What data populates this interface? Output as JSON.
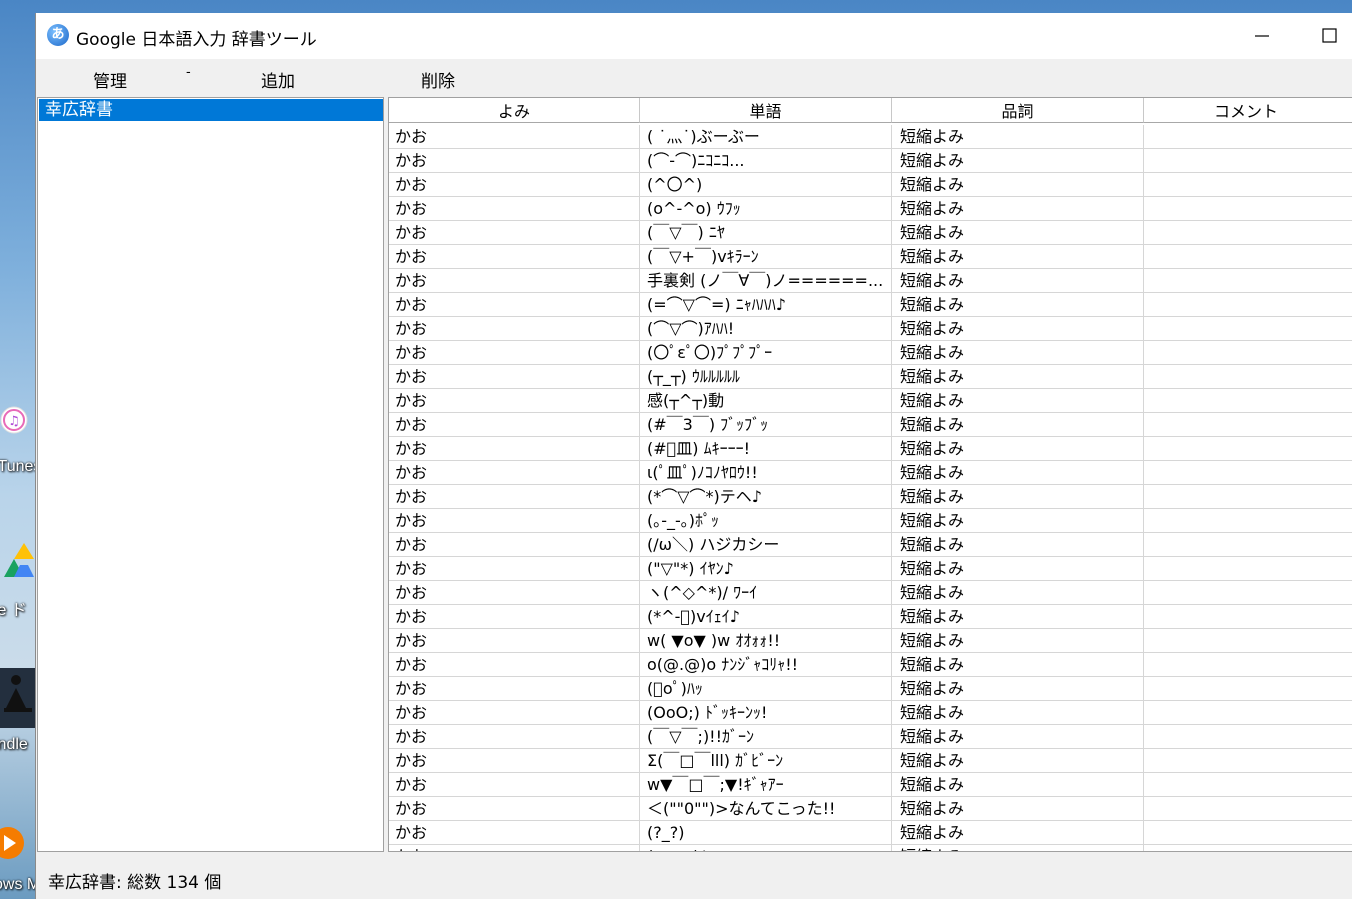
{
  "desktop": {
    "icons": [
      {
        "label": "iTunes",
        "name": "itunes-icon"
      },
      {
        "label": "le ド",
        "name": "google-drive-icon"
      },
      {
        "label": "indle",
        "name": "kindle-icon"
      },
      {
        "label": "ows M",
        "name": "windows-media-icon"
      }
    ]
  },
  "window": {
    "title": "Google 日本語入力 辞書ツール",
    "minimize_label": "—",
    "maximize_label": "☐"
  },
  "menu": {
    "manage": "管理",
    "separator": "-",
    "add": "追加",
    "delete": "削除"
  },
  "dictionaries": [
    "幸広辞書"
  ],
  "table": {
    "columns": [
      "よみ",
      "単語",
      "品詞",
      "コメント"
    ],
    "rows": [
      [
        "かお",
        "( ˙灬˙)ぶーぶー",
        "短縮よみ",
        ""
      ],
      [
        "かお",
        "(⌒-⌒)ﾆｺﾆｺ...",
        "短縮よみ",
        ""
      ],
      [
        "かお",
        "(^〇^)",
        "短縮よみ",
        ""
      ],
      [
        "かお",
        "(o^-^o) ｳﾌｯ",
        "短縮よみ",
        ""
      ],
      [
        "かお",
        "(￣▽￣) ﾆﾔ",
        "短縮よみ",
        ""
      ],
      [
        "かお",
        "(￣▽+￣)vｷﾗｰﾝ",
        "短縮よみ",
        ""
      ],
      [
        "かお",
        "手裏剣 (ノ￣∀￣)ノ======...",
        "短縮よみ",
        ""
      ],
      [
        "かお",
        "(=⌒▽⌒=) ﾆｬﾊﾊﾊ♪",
        "短縮よみ",
        ""
      ],
      [
        "かお",
        "(⌒▽⌒)ｱﾊﾊ!",
        "短縮よみ",
        ""
      ],
      [
        "かお",
        "(〇ﾟεﾟ〇)ﾌﾟﾌﾟﾌﾟｰ",
        "短縮よみ",
        ""
      ],
      [
        "かお",
        "(┬_┬) ｳﾙﾙﾙﾙﾙ",
        "短縮よみ",
        ""
      ],
      [
        "かお",
        "感(┬^┬)動",
        "短縮よみ",
        ""
      ],
      [
        "かお",
        "(#￣3￣) ﾌﾞｯﾌﾞｯ",
        "短縮よみ",
        ""
      ],
      [
        "かお",
        "(#ﾟ皿) ﾑｷｰｰｰ!",
        "短縮よみ",
        ""
      ],
      [
        "かお",
        "ι(ﾟ皿ﾟ)ﾉｺﾉﾔﾛｳ!!",
        "短縮よみ",
        ""
      ],
      [
        "かお",
        "(*⌒▽⌒*)テヘ♪",
        "短縮よみ",
        ""
      ],
      [
        "かお",
        "(｡-_-｡)ﾎﾟｯ",
        "短縮よみ",
        ""
      ],
      [
        "かお",
        "(/ω＼) ハジカシー",
        "短縮よみ",
        ""
      ],
      [
        "かお",
        "(\"▽\"*) ｲﾔﾝ♪",
        "短縮よみ",
        ""
      ],
      [
        "かお",
        "ヽ(^◇^*)/ ﾜｰｲ",
        "短縮よみ",
        ""
      ],
      [
        "かお",
        "(*^-ﾟ)vｲｪｲ♪",
        "短縮よみ",
        ""
      ],
      [
        "かお",
        "w( ▼o▼ )w ｵｵｫｫ!!",
        "短縮よみ",
        ""
      ],
      [
        "かお",
        "o(@.@)o ﾅﾝｼﾞｬｺﾘｬ!!",
        "短縮よみ",
        ""
      ],
      [
        "かお",
        "(ﾟoﾟ)ﾊｯ",
        "短縮よみ",
        ""
      ],
      [
        "かお",
        "(OoO;) ﾄﾞｯｷｰﾝｯ!",
        "短縮よみ",
        ""
      ],
      [
        "かお",
        "(￣▽￣;)!!ｶﾞｰﾝ",
        "短縮よみ",
        ""
      ],
      [
        "かお",
        "Σ(￣□￣lll) ｶﾞﾋﾞｰﾝ",
        "短縮よみ",
        ""
      ],
      [
        "かお",
        "w▼￣□￣;▼!ｷﾞｬｱｰ",
        "短縮よみ",
        ""
      ],
      [
        "かお",
        "＜(\"\"0\"\")>なんてこった!!",
        "短縮よみ",
        ""
      ],
      [
        "かお",
        "(?_?)",
        "短縮よみ",
        ""
      ],
      [
        "かお",
        "(・_・)/~~",
        "短縮よみ",
        ""
      ]
    ]
  },
  "status": {
    "text": "幸広辞書: 総数 134 個"
  }
}
